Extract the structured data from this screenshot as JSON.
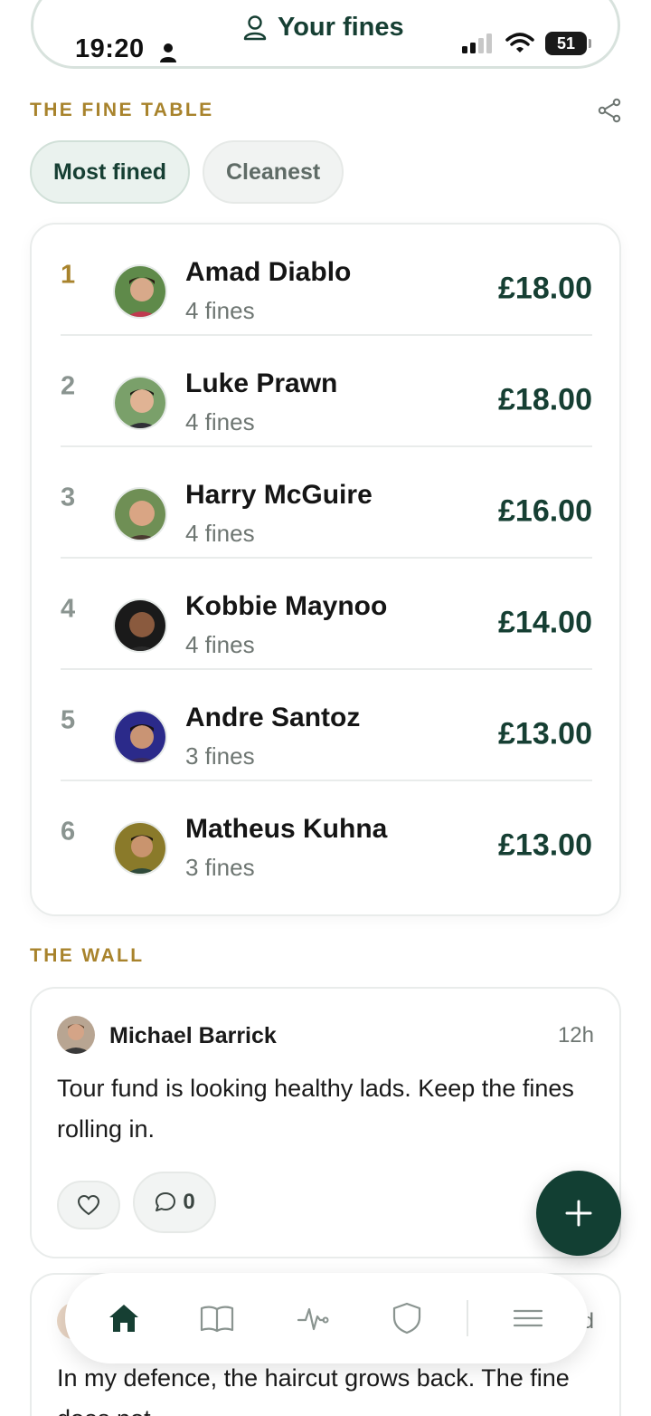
{
  "status_bar": {
    "time": "19:20",
    "battery": "51"
  },
  "header": {
    "title": "Your fines"
  },
  "fine_table": {
    "label": "THE FINE TABLE",
    "tabs": [
      {
        "label": "Most fined",
        "active": true
      },
      {
        "label": "Cleanest",
        "active": false
      }
    ],
    "rows": [
      {
        "rank": "1",
        "name": "Amad Diablo",
        "fines": "4 fines",
        "amount": "£18.00"
      },
      {
        "rank": "2",
        "name": "Luke Prawn",
        "fines": "4 fines",
        "amount": "£18.00"
      },
      {
        "rank": "3",
        "name": "Harry McGuire",
        "fines": "4 fines",
        "amount": "£16.00"
      },
      {
        "rank": "4",
        "name": "Kobbie Maynoo",
        "fines": "4 fines",
        "amount": "£14.00"
      },
      {
        "rank": "5",
        "name": "Andre Santoz",
        "fines": "3 fines",
        "amount": "£13.00"
      },
      {
        "rank": "6",
        "name": "Matheus Kuhna",
        "fines": "3 fines",
        "amount": "£13.00"
      }
    ]
  },
  "wall": {
    "label": "THE WALL",
    "posts": [
      {
        "author": "Michael Barrick",
        "time": "12h",
        "text": "Tour fund is looking healthy lads. Keep the fines rolling in.",
        "comments": "0"
      },
      {
        "author": "",
        "time": "d",
        "text": "In my defence, the haircut grows back. The fine does not."
      }
    ]
  },
  "colors": {
    "brand": "#163f33",
    "accent_gold": "#a8832c"
  },
  "icons": {
    "nav": [
      "home-icon",
      "book-icon",
      "activity-icon",
      "shield-icon",
      "menu-icon"
    ]
  }
}
